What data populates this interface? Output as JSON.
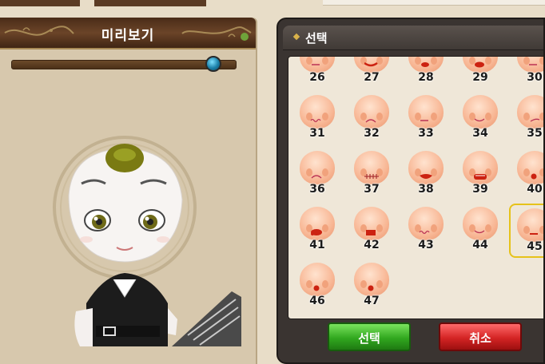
{
  "preview": {
    "title": "미리보기",
    "slider_level": 0.93
  },
  "selection": {
    "title": "선택",
    "selected_id": "45",
    "items": [
      {
        "id": "26",
        "mouth": "line"
      },
      {
        "id": "27",
        "mouth": "red-smile"
      },
      {
        "id": "28",
        "mouth": "red-small"
      },
      {
        "id": "29",
        "mouth": "red-oval"
      },
      {
        "id": "30",
        "mouth": "line"
      },
      {
        "id": "31",
        "mouth": "wavy"
      },
      {
        "id": "32",
        "mouth": "frown"
      },
      {
        "id": "33",
        "mouth": "line"
      },
      {
        "id": "34",
        "mouth": "smile"
      },
      {
        "id": "35",
        "mouth": "side"
      },
      {
        "id": "36",
        "mouth": "frown"
      },
      {
        "id": "37",
        "mouth": "stitched"
      },
      {
        "id": "38",
        "mouth": "red-open"
      },
      {
        "id": "39",
        "mouth": "red-teeth"
      },
      {
        "id": "40",
        "mouth": "red-dot"
      },
      {
        "id": "41",
        "mouth": "red-splat"
      },
      {
        "id": "42",
        "mouth": "red-square"
      },
      {
        "id": "43",
        "mouth": "wavy"
      },
      {
        "id": "44",
        "mouth": "smile"
      },
      {
        "id": "45",
        "mouth": "red-line"
      },
      {
        "id": "46",
        "mouth": "red-dot"
      },
      {
        "id": "47",
        "mouth": "red-dot"
      }
    ]
  },
  "buttons": {
    "ok_label": "선택",
    "cancel_label": "취소"
  },
  "colors": {
    "panel_dark": "#3a3431",
    "ok_green": "#31a81f",
    "cancel_red": "#d42424",
    "selected_border": "#e6c21a"
  }
}
